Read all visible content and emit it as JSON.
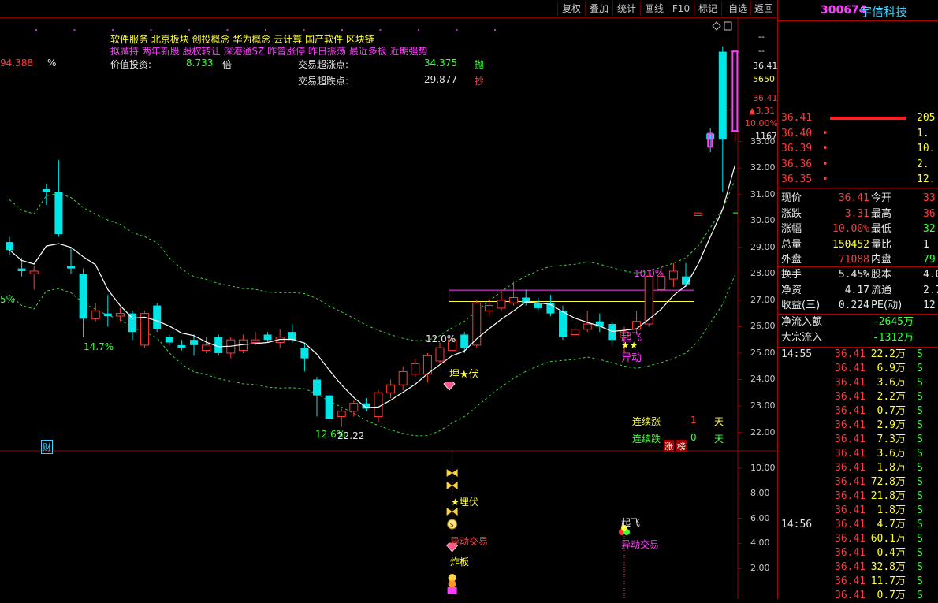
{
  "toolbar": {
    "buttons": [
      "复权",
      "叠加",
      "统计",
      "画线",
      "F10",
      "标记",
      "-自选",
      "返回"
    ]
  },
  "stock": {
    "code": "300674",
    "name": "宇信科技"
  },
  "header_info": {
    "concepts_line1": "软件服务      北京板块       创投概念 华为概念 云计算 国产软件 区块链",
    "concepts_line2": "拟减持 两年新股 股权转让 深港通SZ 昨曾涨停 昨日振荡 最近多板 近期强势",
    "left_partial_value": "94.388",
    "percent_sign": "%",
    "value_label": "价值投资:",
    "value_number": "8.733",
    "value_unit": "倍",
    "over_rise_label": "交易超涨点:",
    "over_rise_value": "34.375",
    "over_rise_action": "抛",
    "over_fall_label": "交易超跌点:",
    "over_fall_value": "29.877",
    "over_fall_action": "抄"
  },
  "price_axis": {
    "labels": [
      "33.00",
      "32.00",
      "31.00",
      "30.00",
      "29.00",
      "28.00",
      "27.00",
      "26.00",
      "25.00",
      "24.00",
      "23.00",
      "22.00"
    ],
    "top_dashes": [
      "--",
      "--"
    ],
    "current_price": "36.41",
    "current_volume": "5650",
    "price_again": "36.41",
    "change": "▲3.31",
    "change_pct": "10.00%",
    "bar_count": "1167"
  },
  "sub_axis": {
    "labels": [
      "10.00",
      "8.00",
      "6.00",
      "4.00",
      "2.00"
    ]
  },
  "annotations": {
    "pct_left": "5%",
    "pct_14_7": "14.7%",
    "pct_12_6": "12.6%",
    "low_price": "22.22",
    "pct_12_0": "12.0%",
    "pct_10_0": "10.0%",
    "ambush": "埋★伏",
    "takeoff": "起飞",
    "stars": "★★",
    "abnormal": "异动",
    "finance_tag": "财",
    "consecutive_up_label": "连续涨",
    "consecutive_up_value": "1",
    "consecutive_down_label": "连续跌",
    "consecutive_down_value": "0",
    "day_unit": "天",
    "limit_badge": "涨",
    "rank_badge": "榜"
  },
  "sub_annotations": {
    "ambush": "★埋伏",
    "abnormal_trade_1": "异动交易",
    "explode_board": "炸板",
    "takeoff": "起飞",
    "abnormal_trade_2": "异动交易"
  },
  "order_book": [
    {
      "price": "36.41",
      "dot": "",
      "qty": "205"
    },
    {
      "price": "36.40",
      "dot": "•",
      "qty": "1."
    },
    {
      "price": "36.39",
      "dot": "•",
      "qty": "10."
    },
    {
      "price": "36.36",
      "dot": "•",
      "qty": "2."
    },
    {
      "price": "36.35",
      "dot": "•",
      "qty": "12."
    }
  ],
  "quote": [
    {
      "l1": "现价",
      "v1": "36.41",
      "l2": "今开",
      "v2": "33"
    },
    {
      "l1": "涨跌",
      "v1": "3.31",
      "l2": "最高",
      "v2": "36"
    },
    {
      "l1": "涨幅",
      "v1": "10.00%",
      "l2": "最低",
      "v2": "32"
    },
    {
      "l1": "总量",
      "v1": "150452",
      "l2": "量比",
      "v2": "1"
    },
    {
      "l1": "外盘",
      "v1": "71088",
      "l2": "内盘",
      "v2": "79"
    }
  ],
  "finance": [
    {
      "l1": "换手",
      "v1": "5.45%",
      "l2": "股本",
      "v2": "4.0"
    },
    {
      "l1": "净资",
      "v1": "4.17",
      "l2": "流通",
      "v2": "2.7"
    },
    {
      "l1": "收益(三)",
      "v1": "0.224",
      "l2": "PE(动)",
      "v2": "12"
    }
  ],
  "flows": [
    {
      "label": "净流入额",
      "value": "-2645万"
    },
    {
      "label": "大宗流入",
      "value": "-1312万"
    }
  ],
  "ticks": [
    {
      "time": "14:55",
      "price": "36.41",
      "vol": "22.2万",
      "side": "S"
    },
    {
      "time": "",
      "price": "36.41",
      "vol": "6.9万",
      "side": "S"
    },
    {
      "time": "",
      "price": "36.41",
      "vol": "3.6万",
      "side": "S"
    },
    {
      "time": "",
      "price": "36.41",
      "vol": "2.2万",
      "side": "S"
    },
    {
      "time": "",
      "price": "36.41",
      "vol": "0.7万",
      "side": "S"
    },
    {
      "time": "",
      "price": "36.41",
      "vol": "2.9万",
      "side": "S"
    },
    {
      "time": "",
      "price": "36.41",
      "vol": "7.3万",
      "side": "S"
    },
    {
      "time": "",
      "price": "36.41",
      "vol": "3.6万",
      "side": "S"
    },
    {
      "time": "",
      "price": "36.41",
      "vol": "1.8万",
      "side": "S"
    },
    {
      "time": "",
      "price": "36.41",
      "vol": "72.8万",
      "side": "S"
    },
    {
      "time": "",
      "price": "36.41",
      "vol": "21.8万",
      "side": "S"
    },
    {
      "time": "",
      "price": "36.41",
      "vol": "1.8万",
      "side": "S"
    },
    {
      "time": "14:56",
      "price": "36.41",
      "vol": "4.7万",
      "side": "S"
    },
    {
      "time": "",
      "price": "36.41",
      "vol": "60.1万",
      "side": "S"
    },
    {
      "time": "",
      "price": "36.41",
      "vol": "0.4万",
      "side": "S"
    },
    {
      "time": "",
      "price": "36.41",
      "vol": "32.8万",
      "side": "S"
    },
    {
      "time": "",
      "price": "36.41",
      "vol": "11.7万",
      "side": "S"
    },
    {
      "time": "",
      "price": "36.41",
      "vol": "0.7万",
      "side": "S"
    }
  ],
  "chart_data": {
    "type": "candlestick",
    "ylim": [
      21.6,
      37.4
    ],
    "hlines": [
      27.38,
      26.95
    ],
    "candles": [
      {
        "o": 29.2,
        "c": 28.9,
        "h": 29.4,
        "l": 28.7
      },
      {
        "o": 28.2,
        "c": 28.1,
        "h": 28.6,
        "l": 27.9
      },
      {
        "o": 28.0,
        "c": 28.1,
        "h": 28.3,
        "l": 27.4
      },
      {
        "o": 31.2,
        "c": 31.1,
        "h": 31.4,
        "l": 30.6
      },
      {
        "o": 31.1,
        "c": 29.5,
        "h": 32.3,
        "l": 29.4
      },
      {
        "o": 28.3,
        "c": 28.2,
        "h": 29.0,
        "l": 28.0
      },
      {
        "o": 28.0,
        "c": 26.3,
        "h": 28.2,
        "l": 25.6
      },
      {
        "o": 26.3,
        "c": 26.6,
        "h": 26.9,
        "l": 26.2
      },
      {
        "o": 26.5,
        "c": 26.4,
        "h": 27.2,
        "l": 26.0
      },
      {
        "o": 26.4,
        "c": 26.5,
        "h": 26.7,
        "l": 26.2
      },
      {
        "o": 26.5,
        "c": 25.8,
        "h": 26.6,
        "l": 25.5
      },
      {
        "o": 25.3,
        "c": 26.5,
        "h": 26.6,
        "l": 25.2
      },
      {
        "o": 26.8,
        "c": 25.9,
        "h": 26.9,
        "l": 25.8
      },
      {
        "o": 25.6,
        "c": 25.4,
        "h": 25.7,
        "l": 25.3
      },
      {
        "o": 25.3,
        "c": 25.2,
        "h": 25.5,
        "l": 25.1
      },
      {
        "o": 25.5,
        "c": 25.3,
        "h": 25.7,
        "l": 24.9
      },
      {
        "o": 25.1,
        "c": 25.3,
        "h": 25.6,
        "l": 25.0
      },
      {
        "o": 25.6,
        "c": 25.0,
        "h": 25.7,
        "l": 24.9
      },
      {
        "o": 25.0,
        "c": 25.5,
        "h": 25.6,
        "l": 24.8
      },
      {
        "o": 25.1,
        "c": 25.5,
        "h": 25.7,
        "l": 25.0
      },
      {
        "o": 25.4,
        "c": 25.5,
        "h": 25.8,
        "l": 25.3
      },
      {
        "o": 25.7,
        "c": 25.5,
        "h": 25.8,
        "l": 25.4
      },
      {
        "o": 25.4,
        "c": 25.6,
        "h": 25.9,
        "l": 25.2
      },
      {
        "o": 25.8,
        "c": 25.5,
        "h": 26.1,
        "l": 25.4
      },
      {
        "o": 25.2,
        "c": 24.8,
        "h": 25.4,
        "l": 24.3
      },
      {
        "o": 24.0,
        "c": 23.4,
        "h": 24.1,
        "l": 22.6
      },
      {
        "o": 23.4,
        "c": 22.5,
        "h": 23.5,
        "l": 22.4
      },
      {
        "o": 22.6,
        "c": 22.8,
        "h": 22.9,
        "l": 22.2
      },
      {
        "o": 22.8,
        "c": 23.1,
        "h": 23.2,
        "l": 22.6
      },
      {
        "o": 23.1,
        "c": 22.9,
        "h": 23.3,
        "l": 22.8
      },
      {
        "o": 22.6,
        "c": 23.5,
        "h": 23.6,
        "l": 22.4
      },
      {
        "o": 23.5,
        "c": 23.8,
        "h": 24.0,
        "l": 23.3
      },
      {
        "o": 23.8,
        "c": 24.3,
        "h": 24.5,
        "l": 23.6
      },
      {
        "o": 24.2,
        "c": 24.6,
        "h": 24.8,
        "l": 24.1
      },
      {
        "o": 24.2,
        "c": 24.9,
        "h": 25.0,
        "l": 23.9
      },
      {
        "o": 24.7,
        "c": 25.2,
        "h": 25.4,
        "l": 24.6
      },
      {
        "o": 25.1,
        "c": 25.5,
        "h": 25.8,
        "l": 25.0
      },
      {
        "o": 25.7,
        "c": 25.2,
        "h": 25.8,
        "l": 25.0
      },
      {
        "o": 25.3,
        "c": 26.9,
        "h": 27.0,
        "l": 25.2
      },
      {
        "o": 26.6,
        "c": 26.8,
        "h": 27.1,
        "l": 26.4
      },
      {
        "o": 26.7,
        "c": 27.0,
        "h": 27.4,
        "l": 26.6
      },
      {
        "o": 26.9,
        "c": 27.1,
        "h": 27.7,
        "l": 26.8
      },
      {
        "o": 27.1,
        "c": 26.9,
        "h": 27.4,
        "l": 26.8
      },
      {
        "o": 26.9,
        "c": 26.7,
        "h": 27.1,
        "l": 26.6
      },
      {
        "o": 26.9,
        "c": 26.5,
        "h": 27.2,
        "l": 26.4
      },
      {
        "o": 26.6,
        "c": 25.6,
        "h": 26.8,
        "l": 25.5
      },
      {
        "o": 25.7,
        "c": 25.9,
        "h": 26.0,
        "l": 25.6
      },
      {
        "o": 25.9,
        "c": 26.1,
        "h": 26.6,
        "l": 25.8
      },
      {
        "o": 26.2,
        "c": 26.0,
        "h": 26.5,
        "l": 25.8
      },
      {
        "o": 26.1,
        "c": 25.5,
        "h": 26.2,
        "l": 25.3
      },
      {
        "o": 25.6,
        "c": 25.8,
        "h": 26.0,
        "l": 25.0
      },
      {
        "o": 25.9,
        "c": 26.2,
        "h": 26.6,
        "l": 25.7
      },
      {
        "o": 26.1,
        "c": 27.9,
        "h": 28.1,
        "l": 26.0
      },
      {
        "o": 27.4,
        "c": 27.9,
        "h": 28.3,
        "l": 27.3
      },
      {
        "o": 27.8,
        "c": 28.1,
        "h": 28.4,
        "l": 27.5
      },
      {
        "o": 27.9,
        "c": 27.6,
        "h": 28.4,
        "l": 27.5
      },
      {
        "o": 30.2,
        "c": 30.3,
        "h": 30.4,
        "l": 30.2
      },
      {
        "o": 33.3,
        "c": 33.1,
        "h": 33.5,
        "l": 32.6
      },
      {
        "o": 36.4,
        "c": 33.1,
        "h": 36.6,
        "l": 31.1
      },
      {
        "o": 33.4,
        "c": 36.41,
        "h": 36.41,
        "l": 33.0
      }
    ]
  }
}
